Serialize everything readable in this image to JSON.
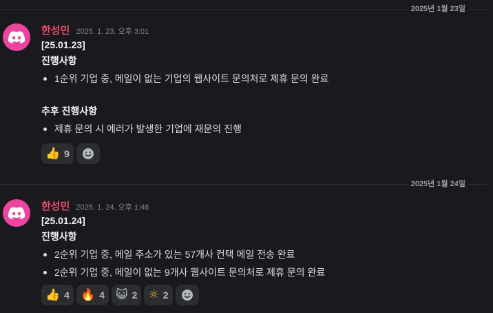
{
  "messages": [
    {
      "date_divider": "2025년 1월 23일",
      "username": "한성민",
      "timestamp": "2025. 1. 23. 오후 3:01",
      "lines": [
        "[25.01.23]",
        "진행사항"
      ],
      "bullets1": [
        "1순위 기업 중, 메일이 없는 기업의 웹사이트 문의처로 제휴 문의 완료"
      ],
      "heading2": "추후 진행사항",
      "bullets2": [
        "제휴 문의 시 에러가 발생한 기업에 재문의 진행"
      ],
      "reactions": [
        {
          "emoji": "👍",
          "count": "9",
          "icon": "thumbs-up-icon"
        }
      ]
    },
    {
      "date_divider": "2025년 1월 24일",
      "username": "한성민",
      "timestamp": "2025. 1. 24. 오후 1:48",
      "lines": [
        "[25.01.24]",
        "진행사항"
      ],
      "bullets1": [
        "2순위 기업 중, 메일 주소가 있는 57개사 컨택 메일 전송 완료",
        "2순위 기업 중, 메일이 없는 9개사 웹사이트 문의처로 제휴 문의 완료"
      ],
      "reactions": [
        {
          "emoji": "👍",
          "count": "4",
          "icon": "thumbs-up-icon"
        },
        {
          "emoji": "🔥",
          "count": "4",
          "icon": "fire-icon"
        },
        {
          "emoji": "😺",
          "count": "2",
          "icon": "smiling-cat-icon"
        },
        {
          "emoji": "☼",
          "count": "2",
          "icon": "sun-icon"
        }
      ]
    }
  ],
  "colors": {
    "background": "#1a1a1e",
    "username": "#e74a6b",
    "avatar": "#eb459f",
    "reaction_bg": "#2b2d31"
  }
}
